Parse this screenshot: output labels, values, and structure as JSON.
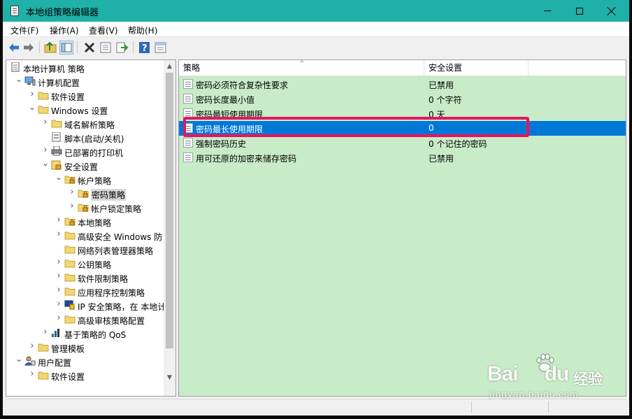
{
  "window": {
    "title": "本地组策略编辑器"
  },
  "menu": [
    "文件(F)",
    "操作(A)",
    "查看(V)",
    "帮助(H)"
  ],
  "toolbar": {
    "buttons": [
      "back-icon",
      "forward-icon",
      "up-folder-icon",
      "show-hide-tree-icon",
      "delete-icon",
      "properties-icon",
      "export-icon",
      "help-icon",
      "view-icon"
    ]
  },
  "tree": {
    "items": [
      {
        "label": "本地计算机 策略",
        "level": 0,
        "expand": "",
        "icon": "policy-doc-icon"
      },
      {
        "label": "计算机配置",
        "level": 1,
        "expand": "open",
        "icon": "computer-icon"
      },
      {
        "label": "软件设置",
        "level": 2,
        "expand": "closed",
        "icon": "folder-icon"
      },
      {
        "label": "Windows 设置",
        "level": 2,
        "expand": "open",
        "icon": "folder-icon"
      },
      {
        "label": "域名解析策略",
        "level": 3,
        "expand": "closed",
        "icon": "folder-icon"
      },
      {
        "label": "脚本(启动/关机)",
        "level": 3,
        "expand": "",
        "icon": "script-icon"
      },
      {
        "label": "已部署的打印机",
        "level": 3,
        "expand": "closed",
        "icon": "printer-icon"
      },
      {
        "label": "安全设置",
        "level": 3,
        "expand": "open",
        "icon": "security-icon"
      },
      {
        "label": "帐户策略",
        "level": 4,
        "expand": "open",
        "icon": "locked-folder-icon"
      },
      {
        "label": "密码策略",
        "level": 5,
        "expand": "closed",
        "icon": "locked-folder-icon",
        "selected": true
      },
      {
        "label": "帐户锁定策略",
        "level": 5,
        "expand": "closed",
        "icon": "locked-folder-icon"
      },
      {
        "label": "本地策略",
        "level": 4,
        "expand": "closed",
        "icon": "locked-folder-icon"
      },
      {
        "label": "高级安全 Windows 防",
        "level": 4,
        "expand": "closed",
        "icon": "folder-icon"
      },
      {
        "label": "网络列表管理器策略",
        "level": 4,
        "expand": "",
        "icon": "folder-icon"
      },
      {
        "label": "公钥策略",
        "level": 4,
        "expand": "closed",
        "icon": "folder-icon"
      },
      {
        "label": "软件限制策略",
        "level": 4,
        "expand": "closed",
        "icon": "folder-icon"
      },
      {
        "label": "应用程序控制策略",
        "level": 4,
        "expand": "closed",
        "icon": "folder-icon"
      },
      {
        "label": "IP 安全策略，在 本地计",
        "level": 4,
        "expand": "closed",
        "icon": "ip-security-icon"
      },
      {
        "label": "高级审核策略配置",
        "level": 4,
        "expand": "closed",
        "icon": "folder-icon"
      },
      {
        "label": "基于策略的 QoS",
        "level": 3,
        "expand": "closed",
        "icon": "qos-chart-icon"
      },
      {
        "label": "管理模板",
        "level": 2,
        "expand": "closed",
        "icon": "folder-icon"
      },
      {
        "label": "用户配置",
        "level": 1,
        "expand": "open",
        "icon": "user-icon"
      },
      {
        "label": "软件设置",
        "level": 2,
        "expand": "closed",
        "icon": "folder-icon"
      }
    ]
  },
  "list": {
    "columns": [
      "策略",
      "安全设置"
    ],
    "rows": [
      {
        "policy": "密码必须符合复杂性要求",
        "setting": "已禁用"
      },
      {
        "policy": "密码长度最小值",
        "setting": "0 个字符"
      },
      {
        "policy": "密码最短使用期限",
        "setting": "0 天"
      },
      {
        "policy": "密码最长使用期限",
        "setting": "0",
        "selected": true
      },
      {
        "policy": "强制密码历史",
        "setting": "0 个记住的密码"
      },
      {
        "policy": "用可还原的加密来储存密码",
        "setting": "已禁用"
      }
    ]
  },
  "colors": {
    "titlebar": "#1fb0a8",
    "list_background": "#c8ebc8",
    "selection": "#0078d7",
    "highlight_frame": "#e8155e"
  },
  "watermark": {
    "brand": "Bai",
    "brand_tail": "du",
    "suffix": "经验",
    "url": "jingyan.baidu.com"
  }
}
